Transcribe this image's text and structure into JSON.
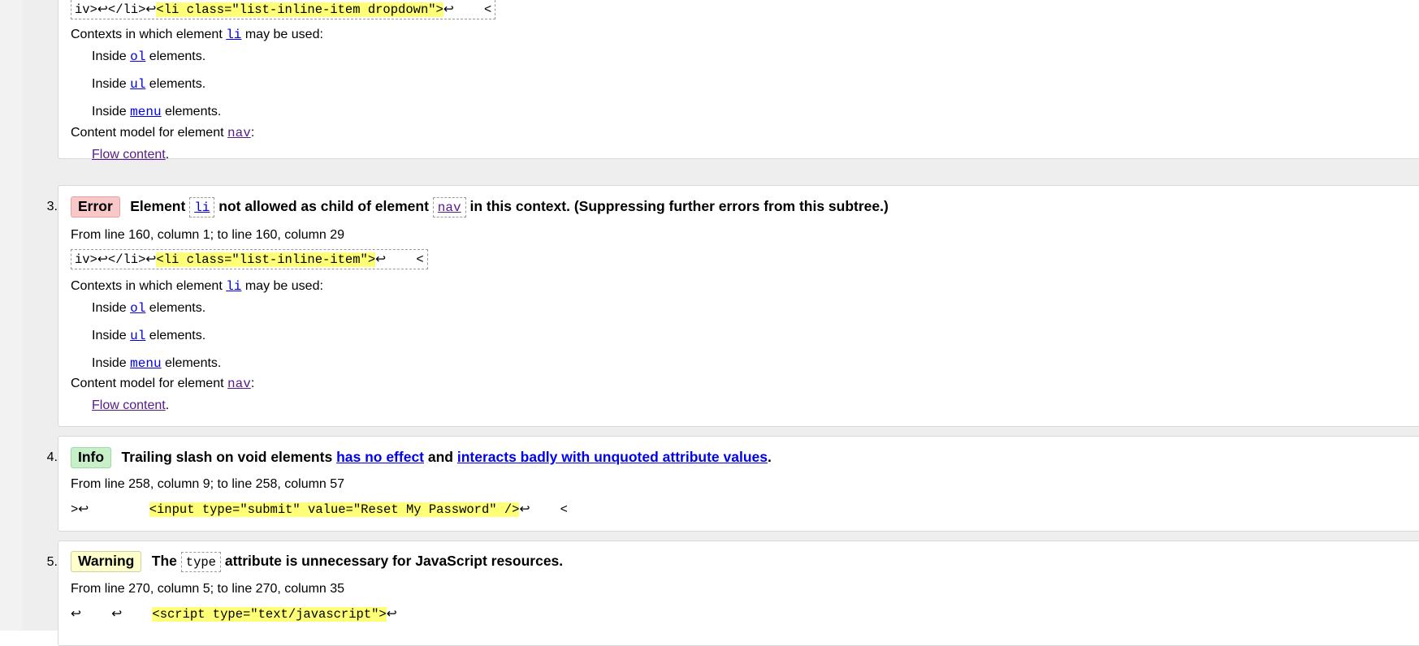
{
  "item2": {
    "extract": {
      "pre": "iv>↩</li>↩",
      "hl": "<li class=\"list-inline-item dropdown\">",
      "post": "↩    <"
    },
    "contexts_prefix": "Contexts in which element ",
    "contexts_el": "li",
    "contexts_suffix": " may be used:",
    "inside": [
      {
        "pre": "Inside ",
        "el": "ol",
        "post": " elements."
      },
      {
        "pre": "Inside ",
        "el": "ul",
        "post": " elements."
      },
      {
        "pre": "Inside ",
        "el": "menu",
        "post": " elements."
      }
    ],
    "model_prefix": "Content model for element ",
    "model_el": "nav",
    "model_suffix": ":",
    "flow": "Flow content",
    "flow_dot": "."
  },
  "item3": {
    "number": "3.",
    "badge": "Error",
    "msg_a": "Element ",
    "code1": "li",
    "msg_b": " not allowed as child of element ",
    "code2": "nav",
    "msg_c": " in this context. (Suppressing further errors from this subtree.)",
    "location": "From line 160, column 1; to line 160, column 29",
    "extract": {
      "pre": "iv>↩</li>↩",
      "hl": "<li class=\"list-inline-item\">",
      "post": "↩    <"
    },
    "contexts_prefix": "Contexts in which element ",
    "contexts_el": "li",
    "contexts_suffix": " may be used:",
    "inside": [
      {
        "pre": "Inside ",
        "el": "ol",
        "post": " elements."
      },
      {
        "pre": "Inside ",
        "el": "ul",
        "post": " elements."
      },
      {
        "pre": "Inside ",
        "el": "menu",
        "post": " elements."
      }
    ],
    "model_prefix": "Content model for element ",
    "model_el": "nav",
    "model_suffix": ":",
    "flow": "Flow content",
    "flow_dot": "."
  },
  "item4": {
    "number": "4.",
    "badge": "Info",
    "msg_a": "Trailing slash on void elements ",
    "link1": "has no effect",
    "msg_b": " and ",
    "link2": "interacts badly with unquoted attribute values",
    "msg_c": ".",
    "location": "From line 258, column 9; to line 258, column 57",
    "extract": {
      "pre": ">↩        ",
      "hl": "<input type=\"submit\" value=\"Reset My Password\" />",
      "post": "↩    <"
    }
  },
  "item5": {
    "number": "5.",
    "badge": "Warning",
    "msg_a": "The ",
    "code1": "type",
    "msg_b": " attribute is unnecessary for JavaScript resources.",
    "location": "From line 270, column 5; to line 270, column 35",
    "extract": {
      "pre": "↩    ↩    ",
      "hl": "<script type=\"text/javascript\">",
      "post": "↩"
    }
  },
  "colors": {
    "error_badge": "#f8c8c8",
    "info_badge": "#c8f0c8",
    "warning_badge": "#ffffcc",
    "highlight": "#ffff77",
    "link": "#0000ee"
  }
}
